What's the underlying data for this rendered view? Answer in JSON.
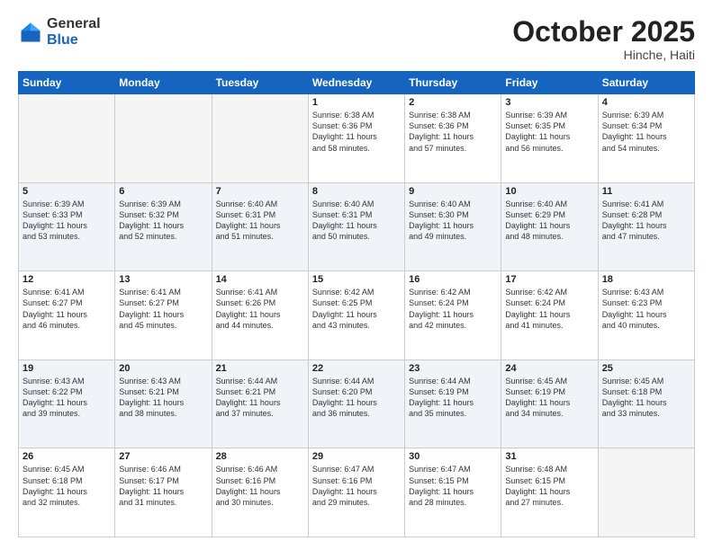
{
  "header": {
    "logo_general": "General",
    "logo_blue": "Blue",
    "month_title": "October 2025",
    "location": "Hinche, Haiti"
  },
  "weekdays": [
    "Sunday",
    "Monday",
    "Tuesday",
    "Wednesday",
    "Thursday",
    "Friday",
    "Saturday"
  ],
  "weeks": [
    [
      {
        "day": "",
        "info": ""
      },
      {
        "day": "",
        "info": ""
      },
      {
        "day": "",
        "info": ""
      },
      {
        "day": "1",
        "info": "Sunrise: 6:38 AM\nSunset: 6:36 PM\nDaylight: 11 hours\nand 58 minutes."
      },
      {
        "day": "2",
        "info": "Sunrise: 6:38 AM\nSunset: 6:36 PM\nDaylight: 11 hours\nand 57 minutes."
      },
      {
        "day": "3",
        "info": "Sunrise: 6:39 AM\nSunset: 6:35 PM\nDaylight: 11 hours\nand 56 minutes."
      },
      {
        "day": "4",
        "info": "Sunrise: 6:39 AM\nSunset: 6:34 PM\nDaylight: 11 hours\nand 54 minutes."
      }
    ],
    [
      {
        "day": "5",
        "info": "Sunrise: 6:39 AM\nSunset: 6:33 PM\nDaylight: 11 hours\nand 53 minutes."
      },
      {
        "day": "6",
        "info": "Sunrise: 6:39 AM\nSunset: 6:32 PM\nDaylight: 11 hours\nand 52 minutes."
      },
      {
        "day": "7",
        "info": "Sunrise: 6:40 AM\nSunset: 6:31 PM\nDaylight: 11 hours\nand 51 minutes."
      },
      {
        "day": "8",
        "info": "Sunrise: 6:40 AM\nSunset: 6:31 PM\nDaylight: 11 hours\nand 50 minutes."
      },
      {
        "day": "9",
        "info": "Sunrise: 6:40 AM\nSunset: 6:30 PM\nDaylight: 11 hours\nand 49 minutes."
      },
      {
        "day": "10",
        "info": "Sunrise: 6:40 AM\nSunset: 6:29 PM\nDaylight: 11 hours\nand 48 minutes."
      },
      {
        "day": "11",
        "info": "Sunrise: 6:41 AM\nSunset: 6:28 PM\nDaylight: 11 hours\nand 47 minutes."
      }
    ],
    [
      {
        "day": "12",
        "info": "Sunrise: 6:41 AM\nSunset: 6:27 PM\nDaylight: 11 hours\nand 46 minutes."
      },
      {
        "day": "13",
        "info": "Sunrise: 6:41 AM\nSunset: 6:27 PM\nDaylight: 11 hours\nand 45 minutes."
      },
      {
        "day": "14",
        "info": "Sunrise: 6:41 AM\nSunset: 6:26 PM\nDaylight: 11 hours\nand 44 minutes."
      },
      {
        "day": "15",
        "info": "Sunrise: 6:42 AM\nSunset: 6:25 PM\nDaylight: 11 hours\nand 43 minutes."
      },
      {
        "day": "16",
        "info": "Sunrise: 6:42 AM\nSunset: 6:24 PM\nDaylight: 11 hours\nand 42 minutes."
      },
      {
        "day": "17",
        "info": "Sunrise: 6:42 AM\nSunset: 6:24 PM\nDaylight: 11 hours\nand 41 minutes."
      },
      {
        "day": "18",
        "info": "Sunrise: 6:43 AM\nSunset: 6:23 PM\nDaylight: 11 hours\nand 40 minutes."
      }
    ],
    [
      {
        "day": "19",
        "info": "Sunrise: 6:43 AM\nSunset: 6:22 PM\nDaylight: 11 hours\nand 39 minutes."
      },
      {
        "day": "20",
        "info": "Sunrise: 6:43 AM\nSunset: 6:21 PM\nDaylight: 11 hours\nand 38 minutes."
      },
      {
        "day": "21",
        "info": "Sunrise: 6:44 AM\nSunset: 6:21 PM\nDaylight: 11 hours\nand 37 minutes."
      },
      {
        "day": "22",
        "info": "Sunrise: 6:44 AM\nSunset: 6:20 PM\nDaylight: 11 hours\nand 36 minutes."
      },
      {
        "day": "23",
        "info": "Sunrise: 6:44 AM\nSunset: 6:19 PM\nDaylight: 11 hours\nand 35 minutes."
      },
      {
        "day": "24",
        "info": "Sunrise: 6:45 AM\nSunset: 6:19 PM\nDaylight: 11 hours\nand 34 minutes."
      },
      {
        "day": "25",
        "info": "Sunrise: 6:45 AM\nSunset: 6:18 PM\nDaylight: 11 hours\nand 33 minutes."
      }
    ],
    [
      {
        "day": "26",
        "info": "Sunrise: 6:45 AM\nSunset: 6:18 PM\nDaylight: 11 hours\nand 32 minutes."
      },
      {
        "day": "27",
        "info": "Sunrise: 6:46 AM\nSunset: 6:17 PM\nDaylight: 11 hours\nand 31 minutes."
      },
      {
        "day": "28",
        "info": "Sunrise: 6:46 AM\nSunset: 6:16 PM\nDaylight: 11 hours\nand 30 minutes."
      },
      {
        "day": "29",
        "info": "Sunrise: 6:47 AM\nSunset: 6:16 PM\nDaylight: 11 hours\nand 29 minutes."
      },
      {
        "day": "30",
        "info": "Sunrise: 6:47 AM\nSunset: 6:15 PM\nDaylight: 11 hours\nand 28 minutes."
      },
      {
        "day": "31",
        "info": "Sunrise: 6:48 AM\nSunset: 6:15 PM\nDaylight: 11 hours\nand 27 minutes."
      },
      {
        "day": "",
        "info": ""
      }
    ]
  ]
}
